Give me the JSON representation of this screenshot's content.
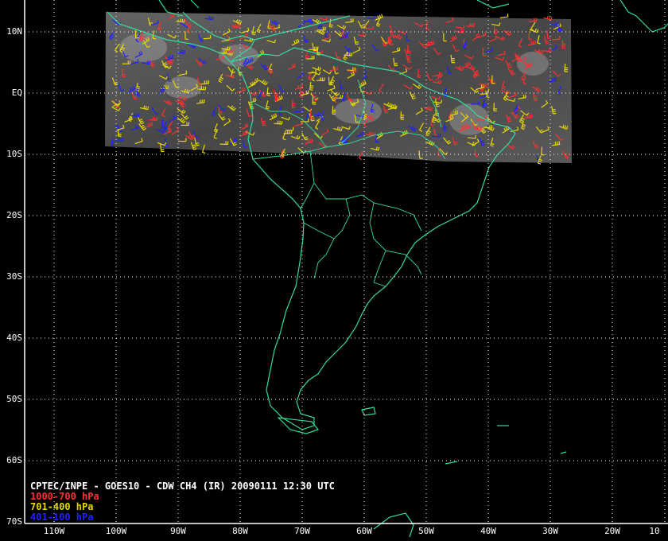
{
  "title": "CPTEC/INPE - GOES10 - CDW CH4 (IR) 20090111 12:30 UTC",
  "legend": [
    {
      "label": "1000-700 hPa",
      "color": "#ff3030"
    },
    {
      "label": "701-400 hPa",
      "color": "#e8d800"
    },
    {
      "label": "401-100 hPa",
      "color": "#2020ff"
    }
  ],
  "lat_labels": [
    "10N",
    "EQ",
    "10S",
    "20S",
    "30S",
    "40S",
    "50S",
    "60S",
    "70S"
  ],
  "lon_labels": [
    "110W",
    "100W",
    "90W",
    "80W",
    "70W",
    "60W",
    "50W",
    "40W",
    "30W",
    "20W",
    "10"
  ],
  "colors": {
    "background": "#000000",
    "coastline": "#33dd99",
    "grid": "#ffffff",
    "frame": "#ffffff",
    "imagery": "#555555"
  }
}
